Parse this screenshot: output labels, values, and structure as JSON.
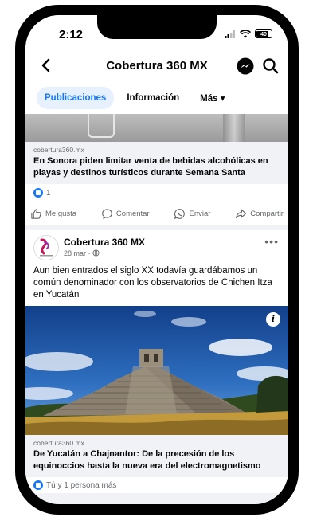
{
  "status": {
    "time": "2:12",
    "battery": "40"
  },
  "nav": {
    "title": "Cobertura 360 MX"
  },
  "tabs": [
    {
      "label": "Publicaciones",
      "active": true
    },
    {
      "label": "Información",
      "active": false
    },
    {
      "label": "Más ▾",
      "active": false
    }
  ],
  "post1": {
    "domain": "cobertura360.mx",
    "title": "En Sonora piden limitar venta de bebidas alcohólicas en playas y destinos turísticos durante Semana Santa",
    "reaction_count": "1",
    "actions": {
      "like": "Me gusta",
      "comment": "Comentar",
      "send": "Enviar",
      "share": "Compartir"
    }
  },
  "post2": {
    "page_name": "Cobertura 360 MX",
    "meta": "28 mar · ",
    "text": "Aun bien entrados el siglo XX todavía guardábamos un común denominador con los observatorios de Chichen Itza en Yucatán",
    "domain": "cobertura360.mx",
    "title": "De Yucatán a Chajnantor: De la precesión de los equinoccios hasta la nueva era del electromagnetismo",
    "reactions": "Tú y 1 persona más"
  },
  "icons": {
    "back": "chevron-left-icon",
    "messenger": "messenger-icon",
    "search": "search-icon",
    "like": "thumbs-up-icon",
    "comment": "comment-icon",
    "send": "whatsapp-icon",
    "share": "share-icon",
    "more": "more-icon",
    "info": "info-icon"
  },
  "colors": {
    "accent": "#1877f2",
    "tab_active_bg": "#e7f0fd",
    "feed_bg": "#f0f2f5"
  }
}
